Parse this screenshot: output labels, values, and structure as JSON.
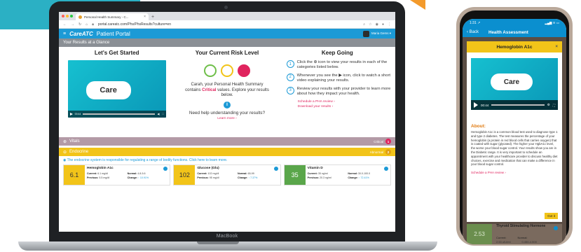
{
  "colors": {
    "brand_blue": "#1c9ad6",
    "critical": "#e0245e",
    "vitals_bar": "#b39aa6",
    "endocrine_bar": "#f2c419",
    "card_yellow": "#f2c419",
    "card_green": "#5aa64a",
    "risk_green": "#6fbf4a",
    "risk_yellow": "#f2c419",
    "risk_red": "#e0245e"
  },
  "browser": {
    "tab_title": "Personal Health Summary - C...",
    "tab_close": "×",
    "new_tab": "+",
    "url": "portal.careatc.com/Phs/PhsResults?culture=en"
  },
  "app": {
    "menu_icon": "hamburger-icon",
    "logo": "CareATC",
    "portal_title": "Patient Portal",
    "user_name": "Maria Gems ▾"
  },
  "glance": {
    "section_title": "Your Results at a Glance",
    "col1_title": "Let's Get Started",
    "col2_title": "Your Current Risk Level",
    "col3_title": "Keep Going",
    "video_logo": "Care",
    "video_time": "00:44",
    "risk_text_pre": "Carah, your Personal Health Summary contains ",
    "risk_text_critical": "Critical",
    "risk_text_post": " values. Explore your results below.",
    "info_icon": "i",
    "help_question": "Need help understanding your results?",
    "learn_more": "Learn more ›",
    "steps": [
      {
        "num": "1",
        "text": "Click the ⊕ icon to view your results in each of the categories listed below."
      },
      {
        "num": "2",
        "text": "Whenever you see the ▶ icon, click to watch a short video explaining your results."
      },
      {
        "num": "3",
        "text": "Review your results with your provider to learn more about how they impact your health."
      }
    ],
    "link_schedule": "Schedule a PHA review ›",
    "link_download": "Download your results ›"
  },
  "vitals": {
    "label": "Vitals",
    "status": "Critical",
    "count": "1"
  },
  "endocrine": {
    "label": "Endocrine",
    "status": "Abnormal",
    "count": "2",
    "note": "The endocrine system is responsible for regulating a range of bodily functions. Click here to learn more.",
    "cards": [
      {
        "score": "6.1",
        "name": "Hemoglobin A1c",
        "current_label": "Current:",
        "current": "6.1 mg/dl",
        "normal_label": "Normal:",
        "normal": "4.8-5.6",
        "previous_label": "Previous:",
        "previous": "5.5 mg/dl",
        "change_label": "Change:",
        "change": "↑ 10.91%"
      },
      {
        "score": "102",
        "name": "Glucose (Glu)",
        "current_label": "Current:",
        "current": "102 mg/dl",
        "normal_label": "Normal:",
        "normal": "65-99",
        "previous_label": "Previous:",
        "previous": "95 mg/dl",
        "change_label": "Change:",
        "change": "↑ 7.37%"
      },
      {
        "score": "35",
        "name": "Vitamin D",
        "current_label": "Current:",
        "current": "35 ng/ml",
        "normal_label": "Normal:",
        "normal": "30.0-100.0",
        "previous_label": "Previous:",
        "previous": "20.3 ng/ml",
        "change_label": "Change:",
        "change": "↑ 72.41%"
      }
    ]
  },
  "laptop_label": "MacBook",
  "phone": {
    "time": "1:31 ↗",
    "signal": "▂▄▆ ≋ ▭",
    "back": "‹ Back",
    "title": "Health Assessment",
    "modal_title": "Hemoglobin A1c",
    "modal_close": "×",
    "video_logo": "Care",
    "video_time": "00:44",
    "about_heading": "About:",
    "about_text": "Hemoglobin A1c is a common blood test used to diagnose type 1 and type 2 diabetes. The test measures the percentage of your hemoglobin (a protein in red blood cells that carries oxygen) that is coated with sugar (glycated). The higher your HgbA1c level, the worse your blood sugar control. Your results show you are in the Diabetic range. It is very important to schedule an appointment with your healthcare provider to discuss healthy diet choices, exercise and medication that can make a difference in your blood sugar control.",
    "schedule_link": "Schedule a PHA review ›",
    "got_it": "Got it",
    "below_score": "2.53",
    "below_title": "Thyroid Stimulating Hormone",
    "below_current_label": "Current:",
    "below_normal_label": "Normal:",
    "below_current": "2.53 uIU/ml",
    "below_normal": "0.450-4.500"
  }
}
